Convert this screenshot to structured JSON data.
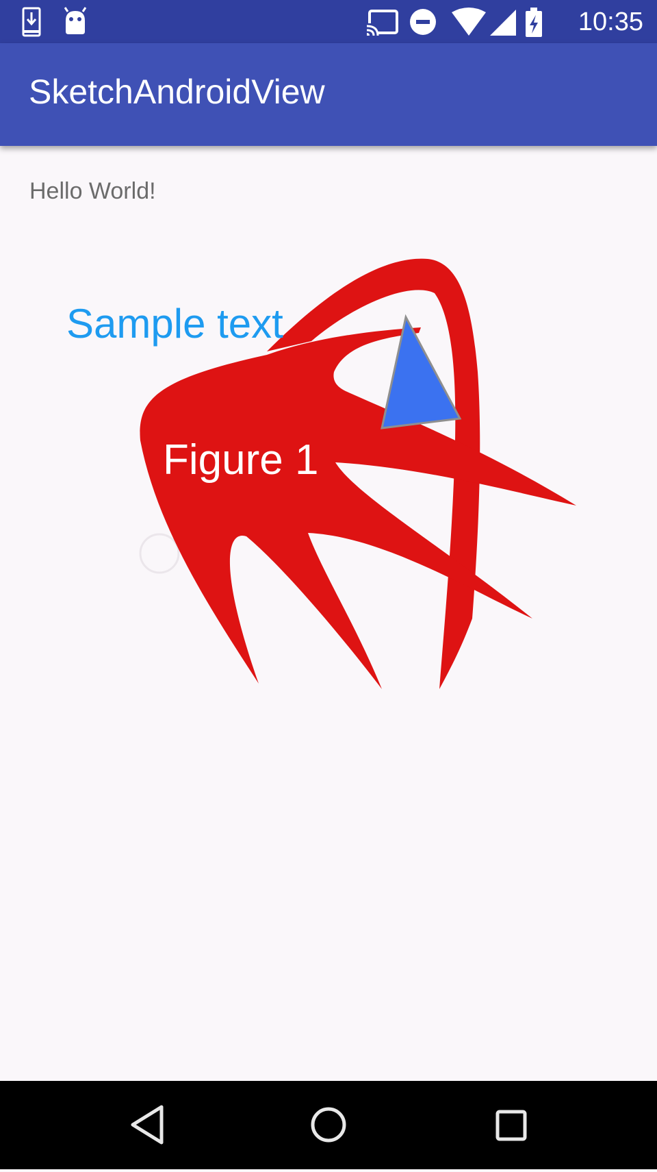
{
  "status_bar": {
    "time": "10:35",
    "icons_left": [
      "download-icon",
      "android-icon"
    ],
    "icons_right": [
      "cast-icon",
      "do-not-disturb-icon",
      "wifi-icon",
      "cell-signal-icon",
      "battery-charging-icon"
    ]
  },
  "app_bar": {
    "title": "SketchAndroidView"
  },
  "content": {
    "hello_text": "Hello World!",
    "sample_text": "Sample text",
    "figure_label": "Figure 1"
  },
  "colors": {
    "status_bar": "#303f9f",
    "app_bar": "#3f51b5",
    "background": "#faf7fa",
    "red_shape": "#de1313",
    "triangle": "#3b72f0",
    "sample_text": "#1e9bf0",
    "hello_text": "#6b6b6b"
  },
  "nav_bar": {
    "buttons": [
      "back-icon",
      "home-icon",
      "recents-icon"
    ]
  }
}
